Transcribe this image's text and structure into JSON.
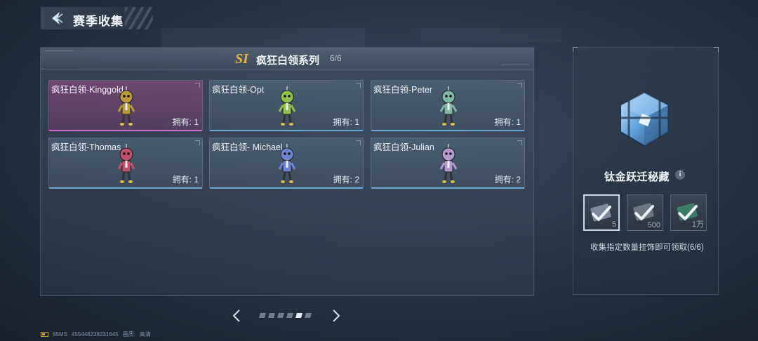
{
  "header": {
    "title": "赛季收集"
  },
  "series": {
    "logo": "SI",
    "name": "疯狂白领系列",
    "count": "6/6"
  },
  "cards": [
    {
      "name": "疯狂白领-Kinggold",
      "owned": "拥有: 1",
      "color": "#b89a3a",
      "selected": true
    },
    {
      "name": "疯狂白领-Opt",
      "owned": "拥有: 1",
      "color": "#8fc04a",
      "selected": false
    },
    {
      "name": "疯狂白领-Peter",
      "owned": "拥有: 1",
      "color": "#7fb9a3",
      "selected": false
    },
    {
      "name": "疯狂白领-Thomas",
      "owned": "拥有: 1",
      "color": "#c0506a",
      "selected": false
    },
    {
      "name": "疯狂白领- Michael",
      "owned": "拥有: 2",
      "color": "#6a86d0",
      "selected": false
    },
    {
      "name": "疯狂白领-Julian",
      "owned": "拥有: 2",
      "color": "#b59ad2",
      "selected": false
    }
  ],
  "pager": {
    "total": 6,
    "active_index": 4
  },
  "reward": {
    "name": "钛金跃迁秘藏",
    "info_icon": "i",
    "tiers": [
      {
        "amount": "5",
        "icon": "check-crate-icon",
        "active": true
      },
      {
        "amount": "500",
        "icon": "check-bar-icon",
        "active": false
      },
      {
        "amount": "1万",
        "icon": "check-green-icon",
        "active": false
      }
    ],
    "description": "收集指定数量挂饰即可领取(6/6)"
  },
  "footer": {
    "ping": "65MS",
    "uid": "455448238231645",
    "quality_label": "画质:",
    "quality": "高清"
  },
  "colors": {
    "accent_gold": "#e9b43a",
    "selected_pink": "#d06ad0",
    "card_line": "#6aa8d8"
  }
}
